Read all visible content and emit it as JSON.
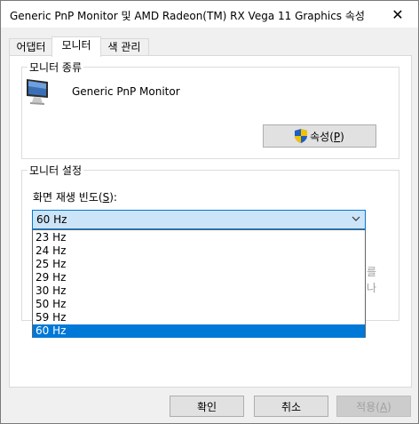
{
  "window": {
    "title": "Generic PnP Monitor 및 AMD Radeon(TM) RX Vega 11 Graphics 속성",
    "close_glyph": "✕"
  },
  "tabs": [
    {
      "label": "어댑터"
    },
    {
      "label": "모니터",
      "active": true
    },
    {
      "label": "색 관리"
    }
  ],
  "monitor_type": {
    "group_label": "모니터 종류",
    "monitor_name": "Generic PnP Monitor",
    "properties_button": {
      "text": "속성",
      "mnemonic": "P"
    }
  },
  "monitor_settings": {
    "group_label": "모니터 설정",
    "refresh_label": {
      "text": "화면 재생 빈도",
      "mnemonic": "S",
      "suffix": ":"
    },
    "selected_value": "60 Hz",
    "options": [
      "23 Hz",
      "24 Hz",
      "25 Hz",
      "29 Hz",
      "30 Hz",
      "50 Hz",
      "59 Hz",
      "60 Hz"
    ],
    "selected_index": 7,
    "obscured_right_text": [
      "를",
      "나"
    ]
  },
  "buttons": {
    "ok": "확인",
    "cancel": "취소",
    "apply": {
      "text": "적용",
      "mnemonic": "A"
    }
  },
  "colors": {
    "accent": "#0078d7",
    "select_bg": "#cce4f7"
  }
}
